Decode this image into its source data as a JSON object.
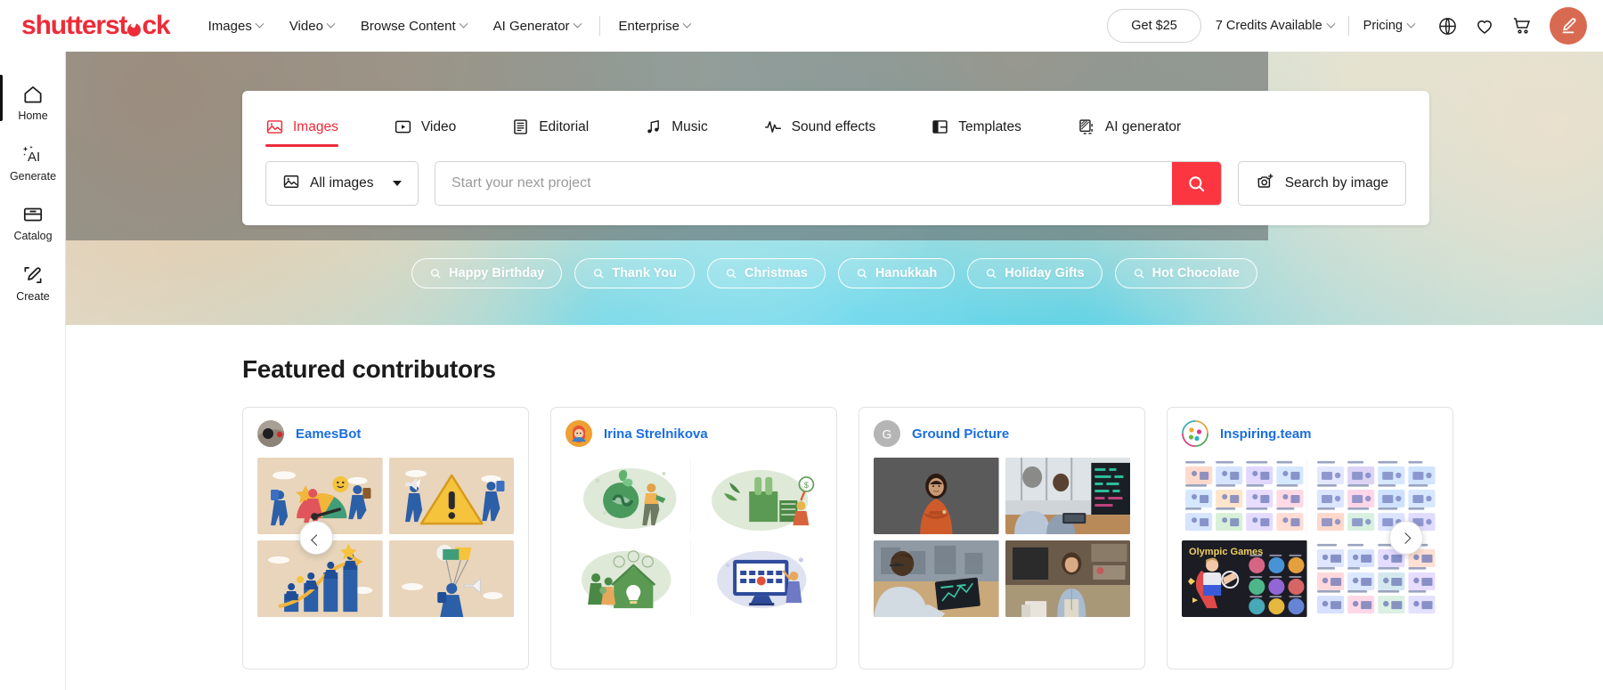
{
  "brand": {
    "name": "shutterstock",
    "accent": "#ee2b38",
    "link_blue": "#1a6ee0",
    "search_red": "#fb3640"
  },
  "header": {
    "nav": [
      {
        "label": "Images",
        "has_caret": true,
        "icon": "chevron-down-icon"
      },
      {
        "label": "Video",
        "has_caret": true,
        "icon": "chevron-down-icon"
      },
      {
        "label": "Browse Content",
        "has_caret": true,
        "icon": "chevron-down-icon"
      },
      {
        "label": "AI Generator",
        "has_caret": true,
        "icon": "chevron-down-icon"
      },
      {
        "label": "Enterprise",
        "has_caret": true,
        "icon": "chevron-down-icon"
      }
    ],
    "get_offer_label": "Get $25",
    "credits_label": "7 Credits Available",
    "pricing_label": "Pricing",
    "icons": {
      "language": "globe-icon",
      "favorites": "heart-icon",
      "cart": "shopping-cart-icon",
      "avatar": "user-avatar-pen-icon"
    }
  },
  "sidebar": {
    "items": [
      {
        "label": "Home",
        "icon": "home-icon",
        "active": true
      },
      {
        "label": "Generate",
        "icon": "ai-sparkle-icon",
        "active": false
      },
      {
        "label": "Catalog",
        "icon": "catalog-drawer-icon",
        "active": false
      },
      {
        "label": "Create",
        "icon": "pencil-create-icon",
        "active": false
      }
    ]
  },
  "search": {
    "tabs": [
      {
        "label": "Images",
        "icon": "image-icon",
        "active": true
      },
      {
        "label": "Video",
        "icon": "video-play-icon",
        "active": false
      },
      {
        "label": "Editorial",
        "icon": "editorial-document-icon",
        "active": false
      },
      {
        "label": "Music",
        "icon": "music-note-icon",
        "active": false
      },
      {
        "label": "Sound effects",
        "icon": "waveform-icon",
        "active": false
      },
      {
        "label": "Templates",
        "icon": "templates-layout-icon",
        "active": false
      },
      {
        "label": "AI generator",
        "icon": "ai-generator-icon",
        "active": false
      }
    ],
    "selector_label": "All images",
    "selector_icon": "image-icon",
    "input_value": "",
    "placeholder": "Start your next project",
    "submit_icon": "search-icon",
    "by_image_label": "Search by image",
    "by_image_icon": "camera-plus-icon"
  },
  "chips": [
    {
      "label": "Happy Birthday",
      "icon": "search-icon"
    },
    {
      "label": "Thank You",
      "icon": "search-icon"
    },
    {
      "label": "Christmas",
      "icon": "search-icon"
    },
    {
      "label": "Hanukkah",
      "icon": "search-icon"
    },
    {
      "label": "Holiday Gifts",
      "icon": "search-icon"
    },
    {
      "label": "Hot Chocolate",
      "icon": "search-icon"
    }
  ],
  "featured": {
    "title": "Featured contributors",
    "prev_icon": "chevron-left-icon",
    "next_icon": "chevron-right-icon",
    "cards": [
      {
        "name": "EamesBot",
        "avatar_style": "photo-dark",
        "thumb_theme": "beige-flat-illustration"
      },
      {
        "name": "Irina Strelnikova",
        "avatar_style": "illustrated-girl",
        "thumb_theme": "green-eco-illustration"
      },
      {
        "name": "Ground Picture",
        "avatar_style": "letter-g",
        "avatar_letter": "G",
        "thumb_theme": "business-photography"
      },
      {
        "name": "Inspiring.team",
        "avatar_style": "color-dots",
        "thumb_theme": "illustration-sets"
      }
    ]
  }
}
